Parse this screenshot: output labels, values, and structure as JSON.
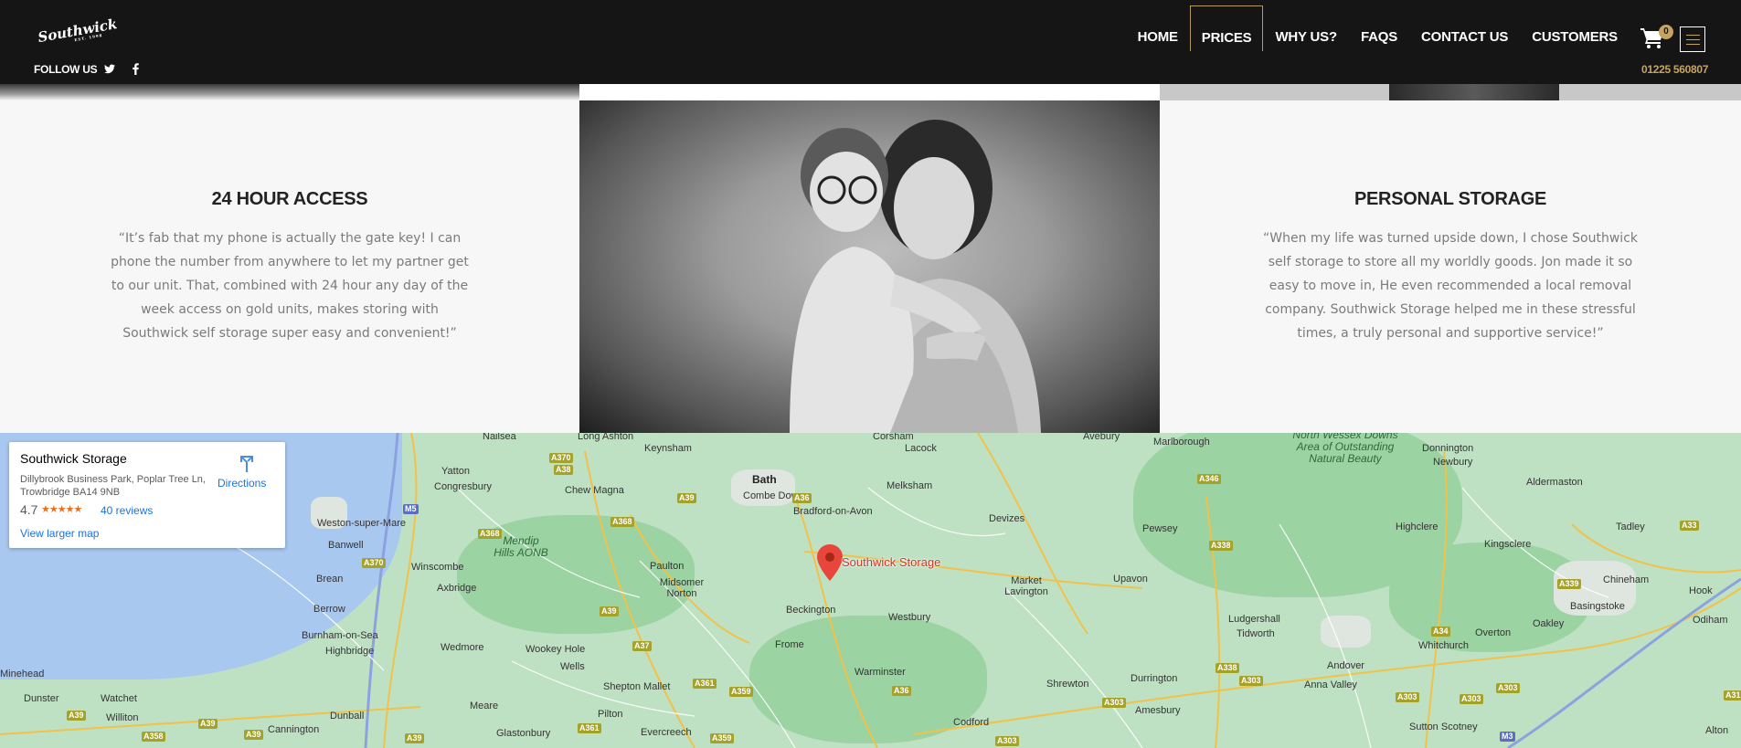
{
  "header": {
    "logo_text": "Southwick",
    "logo_sub": "EST. 1998",
    "follow_label": "FOLLOW US",
    "nav": [
      "HOME",
      "PRICES",
      "WHY US?",
      "FAQS",
      "CONTACT US",
      "CUSTOMERS"
    ],
    "active_nav": "PRICES",
    "cart_count": "0",
    "phone": "01225 560807"
  },
  "testimonials": {
    "left": {
      "title": "24 HOUR ACCESS",
      "quote": "“It’s fab that my phone is actually the gate key!  I can phone the number from anywhere to let my partner get to our unit. That, combined with 24 hour any day of the week access on gold units, makes storing with Southwick self storage super easy and convenient!”"
    },
    "right": {
      "title": "PERSONAL STORAGE",
      "quote": "“When my life was turned upside down, I chose Southwick self storage to store all my worldly goods. Jon made it so easy to move in, He even recommended a local removal company. Southwick Storage helped me in these stressful times, a truly personal and supportive service!”"
    }
  },
  "map": {
    "card": {
      "title": "Southwick Storage",
      "address": "Dillybrook Business Park, Poplar Tree Ln, Trowbridge BA14 9NB",
      "rating": "4.7",
      "stars": "★★★★★",
      "reviews": "40 reviews",
      "larger_map": "View larger map",
      "directions": "Directions"
    },
    "pin_label": "Southwick Storage",
    "places": [
      "Nailsea",
      "Long Ashton",
      "Keynsham",
      "Corsham",
      "Lacock",
      "Avebury",
      "Marlborough",
      "Yatton",
      "Congresbury",
      "Chew Magna",
      "Bath",
      "Combe Down",
      "Melksham",
      "Bradford-on-Avon",
      "Devizes",
      "Weston-super-Mare",
      "Banwell",
      "Winscombe",
      "Paulton",
      "Midsomer Norton",
      "Pewsey",
      "Brean",
      "Axbridge",
      "Market Lavington",
      "Upavon",
      "Berrow",
      "Burnham-on-Sea",
      "Beckington",
      "Westbury",
      "Ludgershall",
      "Highbridge",
      "Wedmore",
      "Wookey Hole",
      "Frome",
      "Tidworth",
      "Wells",
      "Warminster",
      "Shepton Mallet",
      "Shrewton",
      "Durrington",
      "Meare",
      "Pilton",
      "Amesbury",
      "Dunball",
      "Glastonbury",
      "Evercreech",
      "Codford",
      "Minehead",
      "Dunster",
      "Watchet",
      "Williton",
      "Cannington",
      "Donnington",
      "Newbury",
      "Aldermaston",
      "Highclere",
      "Kingsclere",
      "Tadley",
      "Chineham",
      "Basingstoke",
      "Hook",
      "Oakley",
      "Odiham",
      "Whitchurch",
      "Overton",
      "Andover",
      "Anna Valley",
      "Sutton Scotney",
      "Alton"
    ],
    "aonb": [
      "North Wessex Downs Area of Outstanding Natural Beauty",
      "Mendip Hills AONB"
    ],
    "roads": [
      "A370",
      "A38",
      "M5",
      "A368",
      "A39",
      "A36",
      "A361",
      "A37",
      "A359",
      "A303",
      "A338",
      "A346",
      "A34",
      "A33",
      "A339",
      "M3",
      "A358",
      "A31"
    ]
  }
}
